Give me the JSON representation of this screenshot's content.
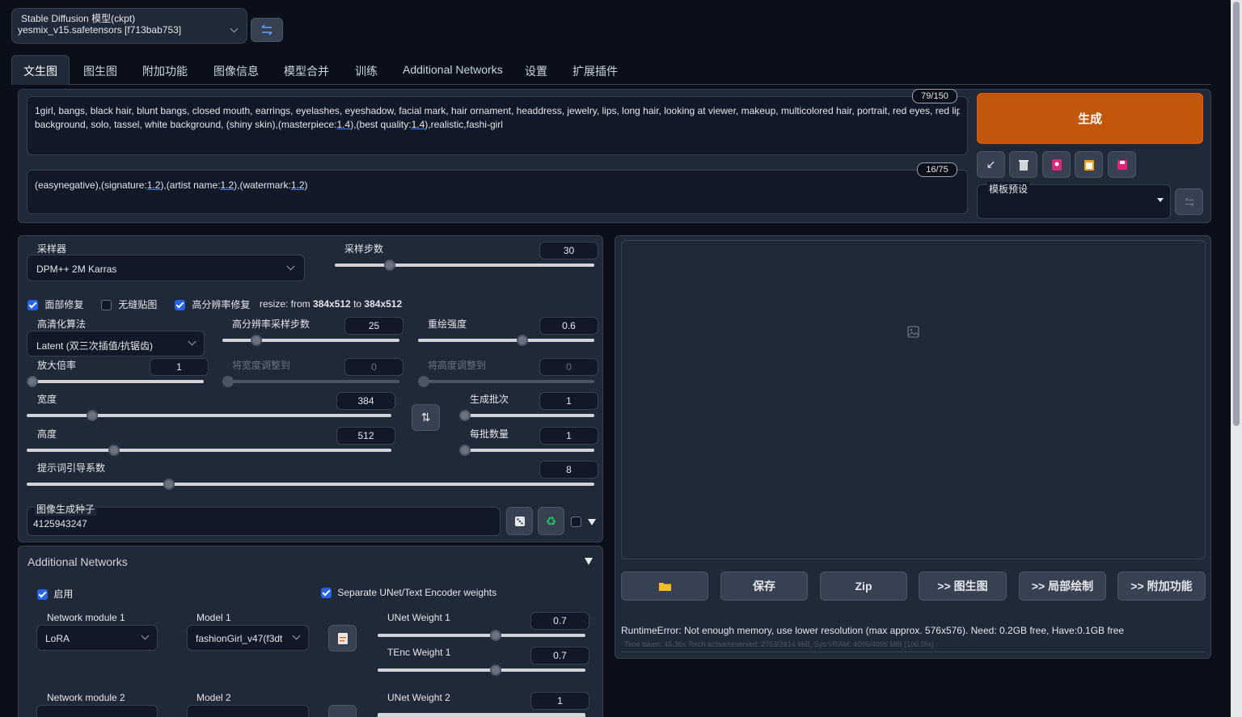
{
  "model_selector": {
    "label": "Stable Diffusion 模型(ckpt)",
    "value": "yesmix_v15.safetensors [f713bab753]"
  },
  "tabs": [
    "文生图",
    "图生图",
    "附加功能",
    "图像信息",
    "模型合并",
    "训练",
    "Additional Networks",
    "设置",
    "扩展插件"
  ],
  "prompt": {
    "counter": "79/150",
    "text_a": "1girl, bangs, black hair, blunt bangs, closed mouth, earrings, eyelashes, eyeshadow, facial mark, hair ornament, headdress, jewelry, lips, long hair, looking at viewer, makeup, multicolored hair, portrait, red eyes, red lips, simple",
    "text_b1": "background, solo, tassel, white background, (shiny skin),(masterpiece:",
    "text_b2": "1.4",
    "text_b3": "),(best quality:",
    "text_b4": "1.4",
    "text_b5": "),realistic,fashi-girl"
  },
  "negative_prompt": {
    "counter": "16/75",
    "p1": "(easynegative),(signature:",
    "p2": "1.2",
    "p3": "),(artist name:",
    "p4": "1.2",
    "p5": "),(watermark:",
    "p6": "1.2",
    "p7": ")"
  },
  "generate_label": "生成",
  "style_preset_label": "模板预设",
  "sampler": {
    "label": "采样器",
    "value": "DPM++ 2M Karras"
  },
  "steps": {
    "label": "采样步数",
    "value": "30",
    "fraction": 0.2
  },
  "checkboxes": {
    "face": "面部修复",
    "tiling": "无缝贴图",
    "hires": "高分辨率修复",
    "resize_prefix": "resize: from ",
    "resize_from": "384x512",
    "resize_mid": " to ",
    "resize_to": "384x512"
  },
  "upscaler": {
    "label": "高清化算法",
    "value": "Latent (双三次插值/抗锯齿)"
  },
  "hires_steps": {
    "label": "高分辨率采样步数",
    "value": "25",
    "fraction": 0.17
  },
  "denoise": {
    "label": "重绘强度",
    "value": "0.6",
    "fraction": 0.6
  },
  "upscale_by": {
    "label": "放大倍率",
    "value": "1",
    "fraction": 0.0
  },
  "resize_w": {
    "label": "将宽度调整到",
    "value": "0",
    "fraction": 0.0
  },
  "resize_h": {
    "label": "将高度调整到",
    "value": "0",
    "fraction": 0.0
  },
  "width": {
    "label": "宽度",
    "value": "384",
    "fraction": 0.17
  },
  "height": {
    "label": "高度",
    "value": "512",
    "fraction": 0.23
  },
  "batch_count": {
    "label": "生成批次",
    "value": "1",
    "fraction": 0.0
  },
  "batch_size": {
    "label": "每批数量",
    "value": "1",
    "fraction": 0.0
  },
  "cfg": {
    "label": "提示词引导系数",
    "value": "8",
    "fraction": 0.245
  },
  "seed": {
    "label": "图像生成种子",
    "value": "4125943247"
  },
  "additional_networks": {
    "title": "Additional Networks",
    "enable": "启用",
    "separate": "Separate UNet/Text Encoder weights",
    "module1_label": "Network module 1",
    "module1_value": "LoRA",
    "model1_label": "Model 1",
    "model1_value": "fashionGirl_v47(f3dt",
    "unet1_label": "UNet Weight 1",
    "unet1_value": "0.7",
    "unet1_fraction": 0.57,
    "tenc1_label": "TEnc Weight 1",
    "tenc1_value": "0.7",
    "tenc1_fraction": 0.57,
    "module2_label": "Network module 2",
    "model2_label": "Model 2",
    "unet2_label": "UNet Weight 2",
    "unet2_value": "1"
  },
  "output_buttons": {
    "save": "保存",
    "zip": "Zip",
    "img2img": ">> 图生图",
    "inpaint": ">> 局部绘制",
    "extras": ">> 附加功能"
  },
  "error_text": "RuntimeError: Not enough memory, use lower resolution (max approx. 576x576). Need: 0.2GB free, Have:0.1GB free",
  "time_text": "Time taken: 45.36s  Torch active/reserved: 2763/2814 MiB, Sys VRAM: 4096/4096 MiB (100.0%)",
  "colors": {
    "accent": "#c2570c",
    "checkbox": "#2563eb"
  }
}
